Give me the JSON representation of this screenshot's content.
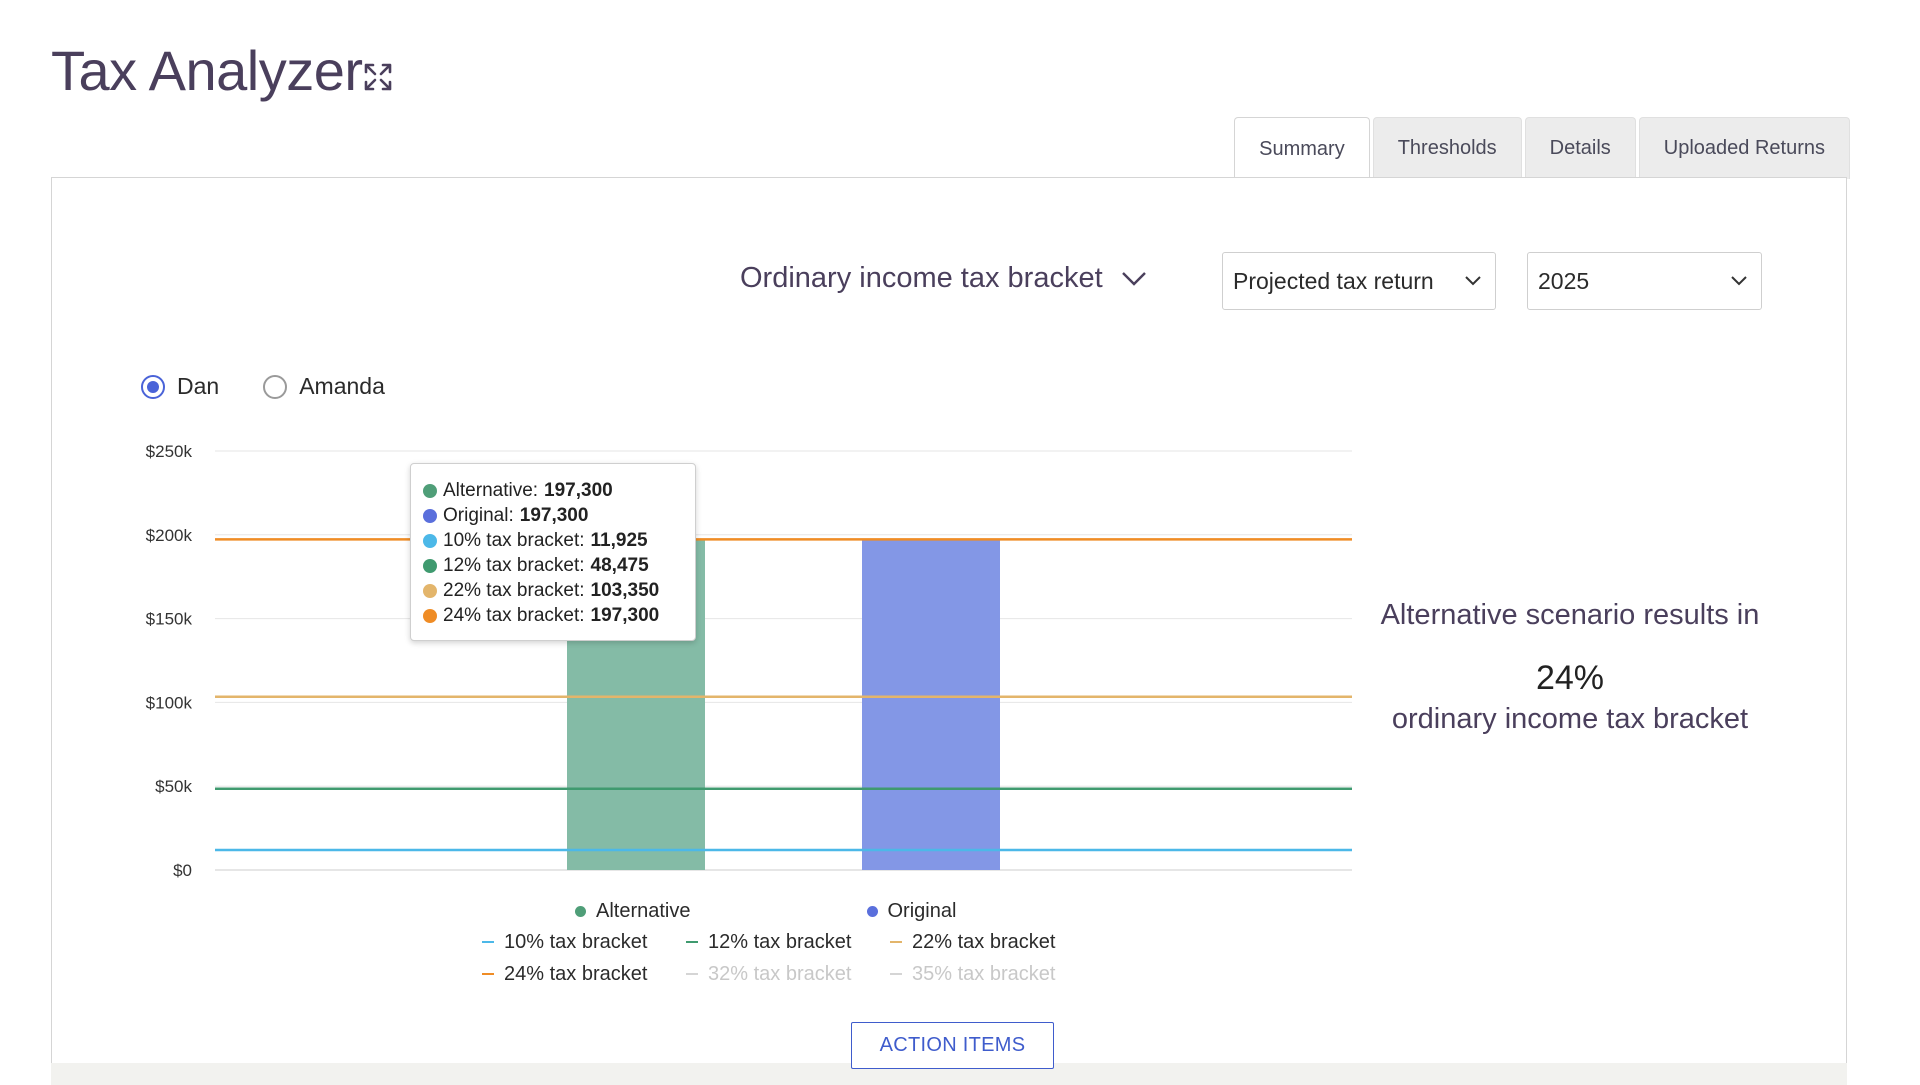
{
  "header": {
    "title": "Tax Analyzer",
    "expand_icon": "expand-arrows-icon"
  },
  "tabs": [
    {
      "label": "Summary",
      "active": true
    },
    {
      "label": "Thresholds",
      "active": false
    },
    {
      "label": "Details",
      "active": false
    },
    {
      "label": "Uploaded Returns",
      "active": false
    }
  ],
  "controls": {
    "metric_label": "Ordinary income tax bracket",
    "return_select": "Projected tax return",
    "year_select": "2025"
  },
  "radios": [
    {
      "label": "Dan",
      "checked": true
    },
    {
      "label": "Amanda",
      "checked": false
    }
  ],
  "tooltip": [
    {
      "label": "Alternative: ",
      "value": "197,300",
      "color": "#4f9e78"
    },
    {
      "label": "Original: ",
      "value": "197,300",
      "color": "#5a6fdc"
    },
    {
      "label": "10% tax bracket: ",
      "value": "11,925",
      "color": "#4cb8e8"
    },
    {
      "label": "12% tax bracket: ",
      "value": "48,475",
      "color": "#3f9a6f"
    },
    {
      "label": "22% tax bracket: ",
      "value": "103,350",
      "color": "#e3b56b"
    },
    {
      "label": "24% tax bracket: ",
      "value": "197,300",
      "color": "#ef8c25"
    }
  ],
  "legend": {
    "series": [
      {
        "label": "Alternative",
        "color": "#4f9e78"
      },
      {
        "label": "Original",
        "color": "#5a6fdc"
      }
    ],
    "lines": [
      {
        "label": "10% tax bracket",
        "color": "#4cb8e8",
        "enabled": true
      },
      {
        "label": "12% tax bracket",
        "color": "#3f9a6f",
        "enabled": true
      },
      {
        "label": "22% tax bracket",
        "color": "#e3b56b",
        "enabled": true
      },
      {
        "label": "24% tax bracket",
        "color": "#ef8c25",
        "enabled": true
      },
      {
        "label": "32% tax bracket",
        "color": "#cfcfcf",
        "enabled": false
      },
      {
        "label": "35% tax bracket",
        "color": "#cfcfcf",
        "enabled": false
      }
    ]
  },
  "result": {
    "heading": "Alternative scenario results in",
    "percent": "24%",
    "description": "ordinary income tax bracket"
  },
  "action_button": "ACTION ITEMS",
  "chart_data": {
    "type": "bar",
    "categories": [
      "Alternative",
      "Original"
    ],
    "values": [
      197300,
      197300
    ],
    "colors": [
      "#84bba6",
      "#8397e6"
    ],
    "ylim": [
      0,
      250000
    ],
    "yticks": [
      0,
      50000,
      100000,
      150000,
      200000,
      250000
    ],
    "ytick_labels": [
      "$0",
      "$50k",
      "$100k",
      "$150k",
      "$200k",
      "$250k"
    ],
    "grid": true,
    "reference_lines": [
      {
        "name": "10% tax bracket",
        "value": 11925,
        "color": "#4cb8e8"
      },
      {
        "name": "12% tax bracket",
        "value": 48475,
        "color": "#3f9a6f"
      },
      {
        "name": "22% tax bracket",
        "value": 103350,
        "color": "#e3b56b"
      },
      {
        "name": "24% tax bracket",
        "value": 197300,
        "color": "#ef8c25"
      }
    ]
  }
}
